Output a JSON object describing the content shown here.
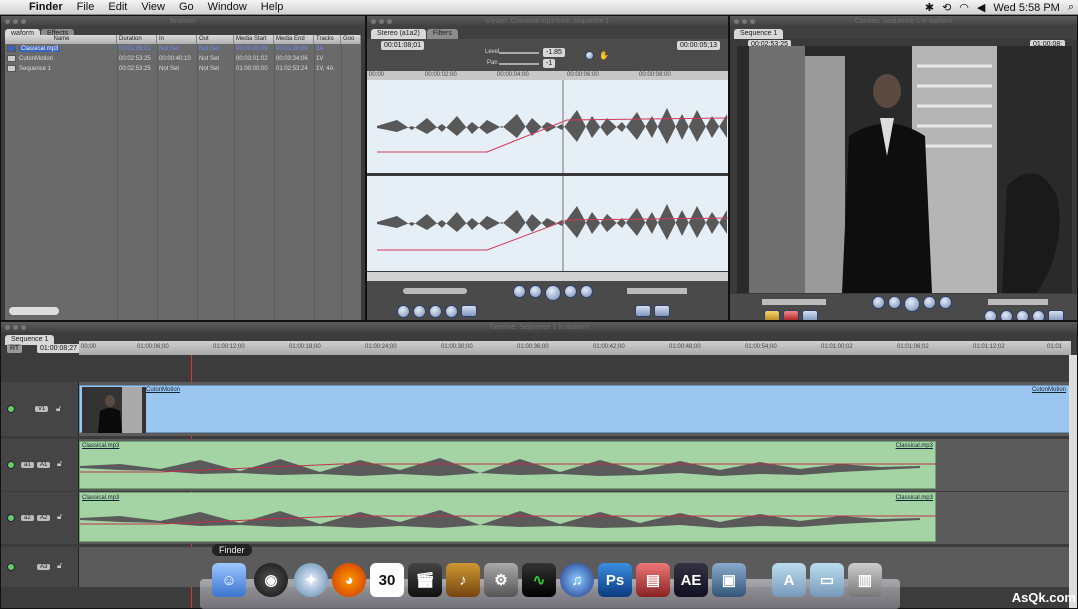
{
  "menubar": {
    "app": "Finder",
    "items": [
      "File",
      "Edit",
      "View",
      "Go",
      "Window",
      "Help"
    ],
    "clock": "Wed 5:58 PM"
  },
  "browser": {
    "title": "Browser",
    "tabs": [
      "waform",
      "Effects"
    ],
    "columns": [
      "Name",
      "Duration",
      "In",
      "Out",
      "Media Start",
      "Media End",
      "Tracks",
      "Goo"
    ],
    "rows": [
      [
        "Classical.mp3",
        "00:01:08:01",
        "Not Set",
        "Not Set",
        "00:00:00;00",
        "00:01:08;00",
        "2A"
      ],
      [
        "CutonMotion",
        "00:02:53:25",
        "00:00:40:10",
        "Not Set",
        "00:03:01:02",
        "00:03:34;06",
        "1V"
      ],
      [
        "Sequence 1",
        "00:02:53:25",
        "Not Set",
        "Not Set",
        "01:00:00;00",
        "01:02:53:24",
        "1V, 4A"
      ]
    ]
  },
  "viewer": {
    "title": "Viewer: Classical.mp3 from Sequence 1",
    "tabs": [
      "Stereo (a1a2)",
      "Filters"
    ],
    "timecode_left": "00:01:08;01",
    "timecode_right": "00:00:05;13",
    "level_label": "Level",
    "level_value": "-1.85",
    "pan_label": "Pan",
    "pan_value": "-1",
    "ruler": [
      "00:00",
      "00:00:02:00",
      "00:00:04:00",
      "00:00:06:00",
      "00:00:08:00"
    ]
  },
  "canvas": {
    "title": "Canvas: Sequence 1 in waform",
    "tab": "Sequence 1",
    "timecode_left": "00:02:53;25",
    "timecode_right": "01:00:08;"
  },
  "timeline": {
    "title": "Timeline: Sequence 1 in waform",
    "tab": "Sequence 1",
    "rt": "RT",
    "timecode": "01:00:08;27",
    "ruler": [
      "00;00",
      "01:00:06;00",
      "01:00:12;00",
      "01:00:18;00",
      "01:00:24;00",
      "01:00:30;00",
      "01:00:36;00",
      "01:00:42;00",
      "01:00:48;00",
      "01:00:54;00",
      "01:01:00;02",
      "01:01:06;02",
      "01:01:12;02",
      "01:01"
    ],
    "tracks": {
      "v1": "V1",
      "a1": "a1",
      "A1": "A1",
      "a2": "a2",
      "A2": "A2",
      "A3": "A3"
    },
    "video_clip": "CutonMotion",
    "video_clip_end": "CutonMotion",
    "audio1": "Classical.mp3",
    "audio1_end": "Classical.mp3",
    "audio2": "Classical.mp3",
    "audio2_end": "Classical.mp3"
  },
  "dock": {
    "tooltip": "Finder",
    "items": [
      "Finder",
      "Dashboard",
      "Safari",
      "Firefox",
      "iCal",
      "Final Cut",
      "GarageBand",
      "System Preferences",
      "Activity Monitor",
      "iTunes",
      "Ps",
      "Soundtrack",
      "AE",
      "iPhoto",
      "Applications",
      "Documents",
      "Trash"
    ],
    "ical_day": "30",
    "ps": "Ps",
    "ae": "AE"
  },
  "watermark": "AsQk.com"
}
